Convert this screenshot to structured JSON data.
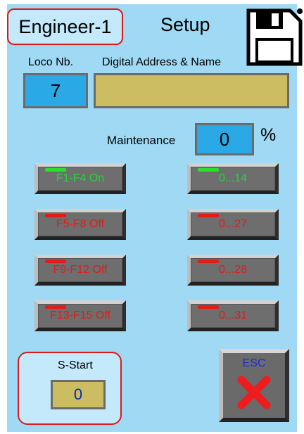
{
  "header": {
    "profile": "Engineer-1",
    "title": "Setup",
    "save_icon": "save-icon"
  },
  "loco": {
    "number_label": "Loco Nb.",
    "number_value": "7",
    "address_label": "Digital Address & Name",
    "address_value": ""
  },
  "maintenance": {
    "label": "Maintenance",
    "value": "0",
    "unit": "%"
  },
  "function_buttons": [
    {
      "label": "F1-F4 On",
      "state": "on"
    },
    {
      "label": "F5-F8 Off",
      "state": "off"
    },
    {
      "label": "F9-F12 Off",
      "state": "off"
    },
    {
      "label": "F13-F15 Off",
      "state": "off"
    }
  ],
  "range_buttons": [
    {
      "label": "0...14",
      "state": "on"
    },
    {
      "label": "0...27",
      "state": "off"
    },
    {
      "label": "0...28",
      "state": "off"
    },
    {
      "label": "0...31",
      "state": "off"
    }
  ],
  "sstart": {
    "label": "S-Start",
    "value": "0"
  },
  "esc": {
    "label": "ESC",
    "icon": "close-icon"
  },
  "colors": {
    "background": "#9fd9f3",
    "field_blue": "#2aa9e6",
    "field_gold": "#cdbd62",
    "indicator_on": "#29e02a",
    "indicator_off": "#e21b1b",
    "frame_red": "#e01818"
  }
}
